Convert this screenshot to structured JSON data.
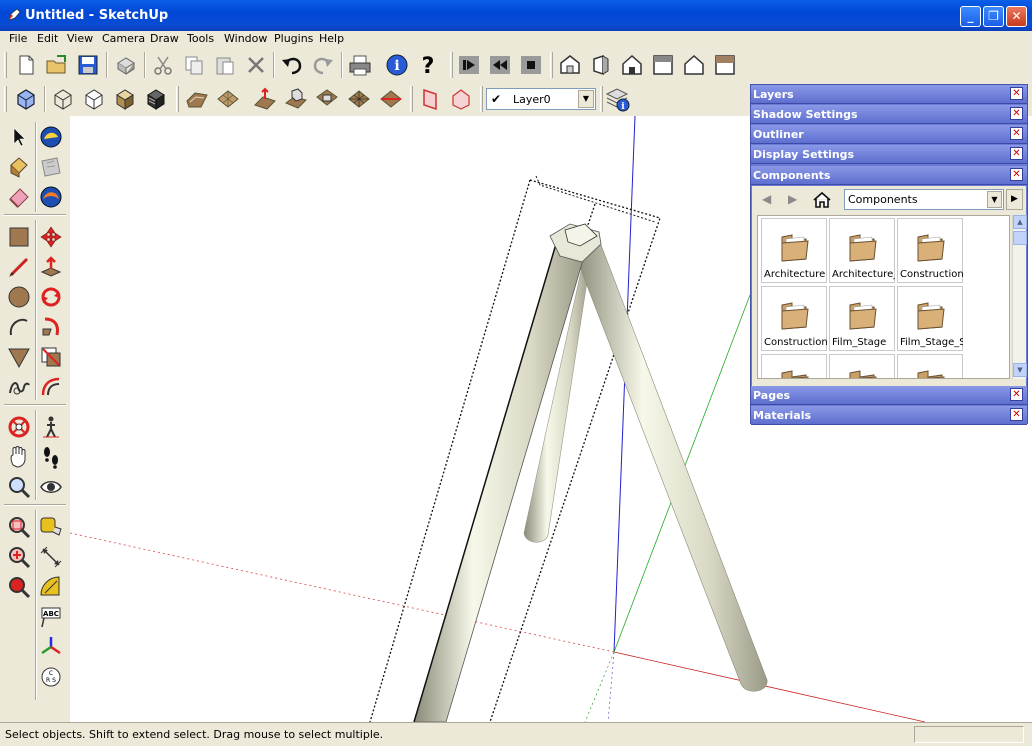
{
  "window": {
    "title": "Untitled - SketchUp",
    "app_icon": "sketchup-pencil-icon",
    "controls": [
      "minimize-icon",
      "restore-icon",
      "close-icon"
    ]
  },
  "menu": {
    "items": [
      "File",
      "Edit",
      "View",
      "Camera",
      "Draw",
      "Tools",
      "Window",
      "Plugins",
      "Help"
    ]
  },
  "toolbar": {
    "row1": [
      "new-icon",
      "open-icon",
      "save-icon",
      "make-component-icon",
      "cut-icon",
      "copy-icon",
      "paste-icon",
      "erase-icon",
      "undo-icon",
      "redo-icon",
      "print-icon",
      "model-info-icon",
      "help-icon",
      "play-icon",
      "previous-scene-icon",
      "stop-icon",
      "iso-view-icon",
      "right-view-icon",
      "front-view-icon",
      "back-view-icon",
      "top-view-icon",
      "left-view-icon"
    ],
    "row2": [
      "xray-icon",
      "wireframe-icon",
      "hidden-line-icon",
      "shaded-icon",
      "shaded-texture-icon",
      "sandbox-from-contours-icon",
      "sandbox-from-scratch-icon",
      "smoove-icon",
      "stamp-icon",
      "drape-icon",
      "add-detail-icon",
      "flip-edge-icon",
      "section-plane-icon",
      "display-section-icon",
      "layer-manager-icon"
    ],
    "layer": {
      "checked": "✔",
      "value": "Layer0"
    }
  },
  "left_tools": [
    "select-icon",
    "make-component-icon",
    "paint-bucket-icon",
    "sandbox-icon",
    "eraser-icon",
    "web-icon",
    "rectangle-icon",
    "move-icon",
    "line-icon",
    "push-pull-icon",
    "circle-icon",
    "rotate-icon",
    "arc-icon",
    "follow-me-icon",
    "polygon-icon",
    "scale-icon",
    "freehand-icon",
    "offset-icon",
    "orbit-icon",
    "walk-icon",
    "pan-icon",
    "footprints-icon",
    "zoom-icon",
    "look-around-icon",
    "zoom-window-icon",
    "tape-measure-icon",
    "zoom-extents-icon",
    "dimension-icon",
    "previous-view-icon",
    "protractor-icon",
    "text-icon",
    "axes-icon",
    "3d-text-icon"
  ],
  "panels": {
    "headers": [
      {
        "label": "Layers"
      },
      {
        "label": "Shadow Settings"
      },
      {
        "label": "Outliner"
      },
      {
        "label": "Display Settings"
      },
      {
        "label": "Components"
      }
    ],
    "footer_headers": [
      {
        "label": "Pages"
      },
      {
        "label": "Materials"
      }
    ],
    "close_glyph": "✕",
    "components": {
      "collection": "Components",
      "items": [
        {
          "label": "Architecture"
        },
        {
          "label": "Architecture_"
        },
        {
          "label": "Construction"
        },
        {
          "label": "Construction_"
        },
        {
          "label": "Film_Stage"
        },
        {
          "label": "Film_Stage_S"
        },
        {
          "label": ""
        },
        {
          "label": ""
        },
        {
          "label": ""
        }
      ]
    }
  },
  "status": {
    "text": "Select objects. Shift to extend select. Drag mouse to select multiple."
  }
}
